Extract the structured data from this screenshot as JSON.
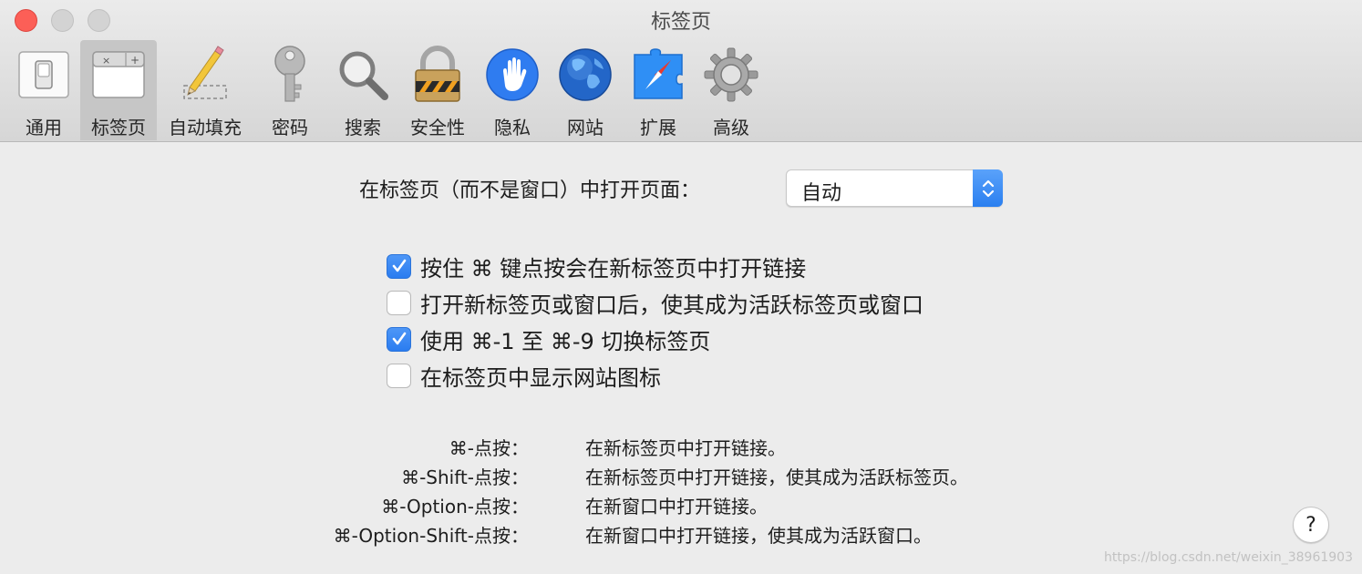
{
  "window": {
    "title": "标签页"
  },
  "toolbar": {
    "tabs": [
      {
        "label": "通用",
        "icon": "switch-icon",
        "selected": false
      },
      {
        "label": "标签页",
        "icon": "tabs-icon",
        "selected": true
      },
      {
        "label": "自动填充",
        "icon": "pencil-icon",
        "selected": false
      },
      {
        "label": "密码",
        "icon": "key-icon",
        "selected": false
      },
      {
        "label": "搜索",
        "icon": "magnifier-icon",
        "selected": false
      },
      {
        "label": "安全性",
        "icon": "padlock-icon",
        "selected": false
      },
      {
        "label": "隐私",
        "icon": "hand-icon",
        "selected": false
      },
      {
        "label": "网站",
        "icon": "globe-icon",
        "selected": false
      },
      {
        "label": "扩展",
        "icon": "extension-icon",
        "selected": false
      },
      {
        "label": "高级",
        "icon": "gear-icon",
        "selected": false
      }
    ]
  },
  "content": {
    "open_pages_label": "在标签页（而不是窗口）中打开页面：",
    "open_pages_value": "自动",
    "checkboxes": [
      {
        "label": "按住 ⌘ 键点按会在新标签页中打开链接",
        "checked": true
      },
      {
        "label": "打开新标签页或窗口后，使其成为活跃标签页或窗口",
        "checked": false
      },
      {
        "label": "使用 ⌘-1 至 ⌘-9 切换标签页",
        "checked": true
      },
      {
        "label": "在标签页中显示网站图标",
        "checked": false
      }
    ],
    "shortcuts": [
      {
        "key": "⌘-点按：",
        "desc": "在新标签页中打开链接。"
      },
      {
        "key": "⌘-Shift-点按：",
        "desc": "在新标签页中打开链接，使其成为活跃标签页。"
      },
      {
        "key": "⌘-Option-点按：",
        "desc": "在新窗口中打开链接。"
      },
      {
        "key": "⌘-Option-Shift-点按：",
        "desc": "在新窗口中打开链接，使其成为活跃窗口。"
      }
    ],
    "help_label": "?"
  },
  "watermark": "https://blog.csdn.net/weixin_38961903",
  "colors": {
    "accent": "#2a7ff0",
    "close": "#fc5f57"
  }
}
